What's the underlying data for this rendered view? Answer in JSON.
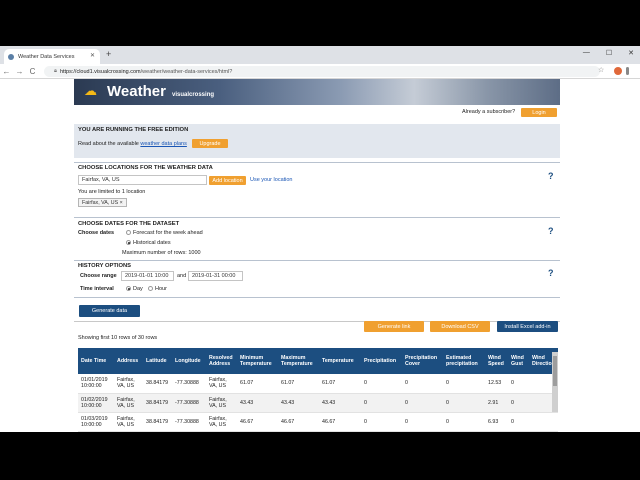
{
  "browser": {
    "tab_title": "Weather Data Services",
    "new_tab": "+",
    "url_domain": "https://cloud1.visualcrossing.com",
    "url_path": "/weather/weather-data-services/html?",
    "back": "←",
    "forward": "→",
    "reload": "C",
    "star": "☆"
  },
  "banner": {
    "sun": "☁",
    "title": "Weather",
    "brand": "visualcrossing"
  },
  "subscriber": {
    "text": "Already a subscriber?",
    "login": "Login"
  },
  "free": {
    "heading": "YOU ARE RUNNING THE FREE EDITION",
    "text_prefix": "Read about the available",
    "plans_link": "weather data plans",
    "upgrade": "Upgrade"
  },
  "locations": {
    "heading": "CHOOSE LOCATIONS FOR THE WEATHER DATA",
    "input_value": "Fairfax, VA, US",
    "add": "Add location",
    "use_yours": "Use your location",
    "limit": "You are limited to 1 location",
    "chip": "Fairfax, VA, US ×",
    "help": "?"
  },
  "dates": {
    "heading": "CHOOSE DATES FOR THE DATASET",
    "label": "Choose dates",
    "forecast": "Forecast for the week ahead",
    "historical": "Historical dates",
    "max_rows": "Maximum number of rows: 1000",
    "help": "?"
  },
  "history": {
    "heading": "HISTORY OPTIONS",
    "range_label": "Choose range",
    "start": "2019-01-01 10:00",
    "and": "and",
    "end": "2019-01-31 00:00",
    "interval_label": "Time interval",
    "day": "Day",
    "hour": "Hour",
    "help": "?"
  },
  "generate": "Generate data",
  "actions": {
    "link": "Generate link",
    "csv": "Download CSV",
    "excel": "Install Excel add-in"
  },
  "showing": "Showing first 10 rows of 30 rows",
  "table": {
    "headers": [
      "Date Time",
      "Address",
      "Latitude",
      "Longitude",
      "Resolved Address",
      "Minimum Temperature",
      "Maximum Temperature",
      "Temperature",
      "Precipitation",
      "Precipitation Cover",
      "Estimated precipitation",
      "Wind Speed",
      "Wind Gust",
      "Wind Direction"
    ],
    "rows": [
      [
        "01/01/2019 10:00:00",
        "Fairfax, VA, US",
        "38.84179",
        "-77.30888",
        "Fairfax, VA, US",
        "61.07",
        "61.07",
        "61.07",
        "0",
        "0",
        "0",
        "12.53",
        "0",
        ""
      ],
      [
        "01/02/2019 10:00:00",
        "Fairfax, VA, US",
        "38.84179",
        "-77.30888",
        "Fairfax, VA, US",
        "43.43",
        "43.43",
        "43.43",
        "0",
        "0",
        "0",
        "2.91",
        "0",
        ""
      ],
      [
        "01/03/2019 10:00:00",
        "Fairfax, VA, US",
        "38.84179",
        "-77.30888",
        "Fairfax, VA, US",
        "46.67",
        "46.67",
        "46.67",
        "0",
        "0",
        "0",
        "6.93",
        "0",
        ""
      ]
    ]
  }
}
